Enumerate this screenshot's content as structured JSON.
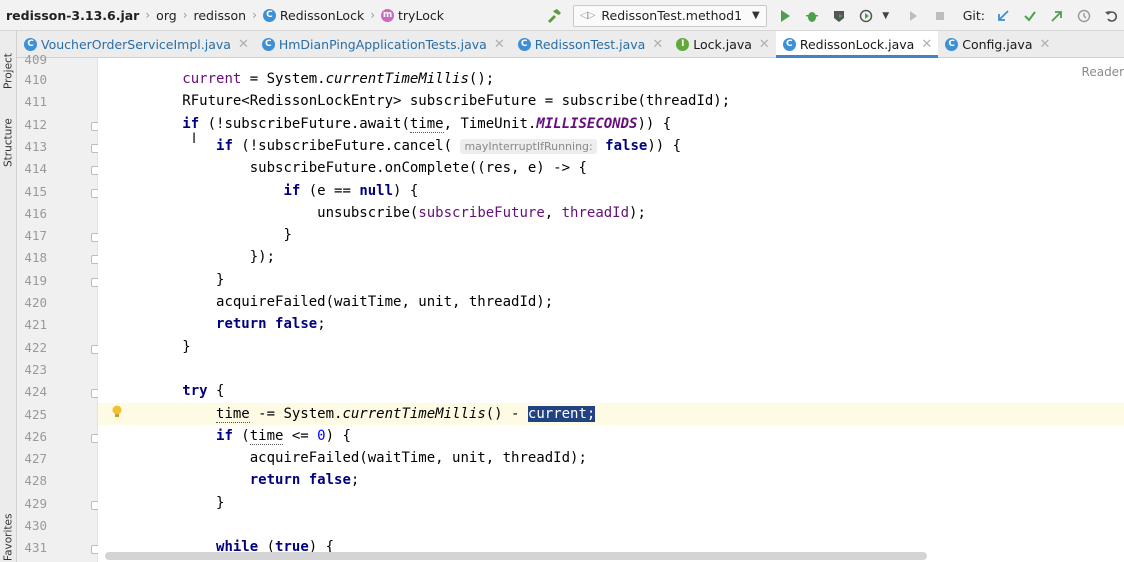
{
  "navbar": {
    "crumbs": [
      {
        "label": "redisson-3.13.6.jar"
      },
      {
        "label": "org"
      },
      {
        "label": "redisson"
      },
      {
        "label": "RedissonLock",
        "badge": "C"
      },
      {
        "label": "tryLock",
        "badge": "m"
      }
    ],
    "run_config": "RedissonTest.method1",
    "git_label": "Git:"
  },
  "tabs": [
    {
      "label": "VoucherOrderServiceImpl.java",
      "badge": "C"
    },
    {
      "label": "HmDianPingApplicationTests.java",
      "badge": "C"
    },
    {
      "label": "RedissonTest.java",
      "badge": "C"
    },
    {
      "label": "Lock.java",
      "badge": "I"
    },
    {
      "label": "RedissonLock.java",
      "badge": "C"
    },
    {
      "label": "Config.java",
      "badge": "C"
    }
  ],
  "side_tools": {
    "project": "Project",
    "structure": "Structure",
    "favorites": "Favorites"
  },
  "editor": {
    "reader_mode": "Reader",
    "first_partial_line": "409",
    "lines": [
      {
        "n": "410",
        "toks": [
          [
            "current",
            "fld"
          ],
          [
            " = System.",
            ""
          ],
          [
            "currentTimeMillis",
            "ital"
          ],
          [
            "();",
            ""
          ]
        ]
      },
      {
        "n": "411",
        "toks": [
          [
            "RFuture<RedissonLockEntry> subscribeFuture = subscribe(threadId);",
            ""
          ]
        ]
      },
      {
        "n": "412",
        "toks": [
          [
            "if",
            "kw"
          ],
          [
            " (!subscribeFuture.await(",
            ""
          ],
          [
            "time",
            "underline"
          ],
          [
            ", TimeUnit.",
            ""
          ],
          [
            "MILLISECONDS",
            "const"
          ],
          [
            ")) {",
            ""
          ]
        ]
      },
      {
        "n": "413",
        "toks": [
          [
            "    ",
            ""
          ],
          [
            "if",
            "kw"
          ],
          [
            " (!subscribeFuture.cancel( ",
            ""
          ],
          [
            "mayInterruptIfRunning:",
            "hint"
          ],
          [
            " ",
            ""
          ],
          [
            "false",
            "kw"
          ],
          [
            ")) {",
            ""
          ]
        ]
      },
      {
        "n": "414",
        "toks": [
          [
            "        subscribeFuture.onComplete((res, e) -> {",
            ""
          ]
        ]
      },
      {
        "n": "415",
        "toks": [
          [
            "            ",
            ""
          ],
          [
            "if",
            "kw"
          ],
          [
            " (e == ",
            ""
          ],
          [
            "null",
            "kw"
          ],
          [
            ") {",
            ""
          ]
        ]
      },
      {
        "n": "416",
        "toks": [
          [
            "                unsubscribe(",
            ""
          ],
          [
            "subscribeFuture",
            "fld"
          ],
          [
            ", ",
            ""
          ],
          [
            "threadId",
            "fld"
          ],
          [
            ");",
            ""
          ]
        ]
      },
      {
        "n": "417",
        "toks": [
          [
            "            }",
            ""
          ]
        ]
      },
      {
        "n": "418",
        "toks": [
          [
            "        });",
            ""
          ]
        ]
      },
      {
        "n": "419",
        "toks": [
          [
            "    }",
            ""
          ]
        ]
      },
      {
        "n": "420",
        "toks": [
          [
            "    acquireFailed(waitTime, unit, threadId);",
            ""
          ]
        ]
      },
      {
        "n": "421",
        "toks": [
          [
            "    ",
            ""
          ],
          [
            "return",
            "kw"
          ],
          [
            " ",
            ""
          ],
          [
            "false",
            "kw"
          ],
          [
            ";",
            ""
          ]
        ]
      },
      {
        "n": "422",
        "toks": [
          [
            "}",
            ""
          ]
        ]
      },
      {
        "n": "423",
        "toks": []
      },
      {
        "n": "424",
        "toks": [
          [
            "try",
            "kw"
          ],
          [
            " {",
            ""
          ]
        ]
      },
      {
        "n": "425",
        "toks": [
          [
            "    ",
            ""
          ],
          [
            "time",
            "underline"
          ],
          [
            " -= System.",
            ""
          ],
          [
            "currentTimeMillis",
            "ital"
          ],
          [
            "() - ",
            ""
          ],
          [
            "current;",
            "sel"
          ]
        ]
      },
      {
        "n": "426",
        "toks": [
          [
            "    ",
            ""
          ],
          [
            "if",
            "kw"
          ],
          [
            " (",
            ""
          ],
          [
            "time",
            "underline"
          ],
          [
            " <= ",
            ""
          ],
          [
            "0",
            "num"
          ],
          [
            ") {",
            ""
          ]
        ]
      },
      {
        "n": "427",
        "toks": [
          [
            "        acquireFailed(waitTime, unit, threadId);",
            ""
          ]
        ]
      },
      {
        "n": "428",
        "toks": [
          [
            "        ",
            ""
          ],
          [
            "return",
            "kw"
          ],
          [
            " ",
            ""
          ],
          [
            "false",
            "kw"
          ],
          [
            ";",
            ""
          ]
        ]
      },
      {
        "n": "429",
        "toks": [
          [
            "    }",
            ""
          ]
        ]
      },
      {
        "n": "430",
        "toks": []
      },
      {
        "n": "431",
        "toks": [
          [
            "    ",
            ""
          ],
          [
            "while",
            "kw"
          ],
          [
            " (",
            ""
          ],
          [
            "true",
            "kw"
          ],
          [
            ") {",
            ""
          ]
        ]
      }
    ]
  },
  "colors": {
    "keyword": "#000080",
    "field": "#660e7a",
    "selection": "#214283",
    "accent": "#4083c9"
  }
}
